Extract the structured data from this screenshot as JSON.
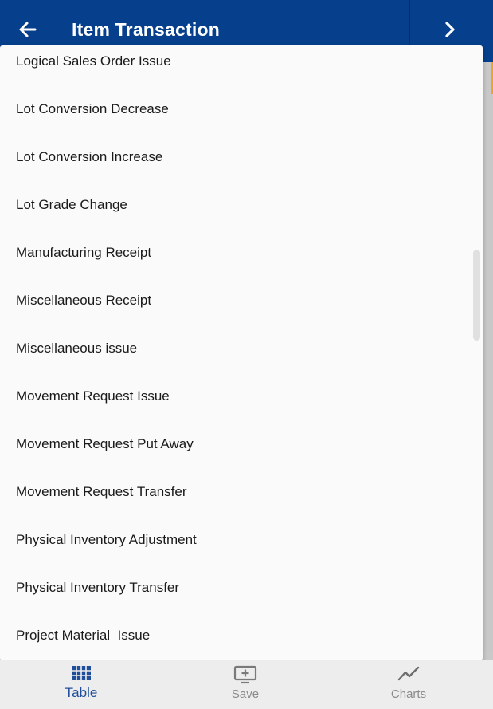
{
  "header": {
    "title": "Item Transaction",
    "background": "#063f8c"
  },
  "dropdown": {
    "options": [
      "Logical Sales Order Issue",
      "Lot Conversion Decrease",
      "Lot Conversion Increase",
      "Lot Grade Change",
      "Manufacturing Receipt",
      "Miscellaneous Receipt",
      "Miscellaneous issue",
      "Movement Request Issue",
      "Movement Request Put Away",
      "Movement Request Transfer",
      "Physical Inventory Adjustment",
      "Physical Inventory Transfer",
      "Project Material  Issue"
    ]
  },
  "bottom_nav": {
    "table_label": "Table",
    "save_label": "Save",
    "charts_label": "Charts",
    "active": "Table",
    "active_color": "#1f4f9a"
  }
}
